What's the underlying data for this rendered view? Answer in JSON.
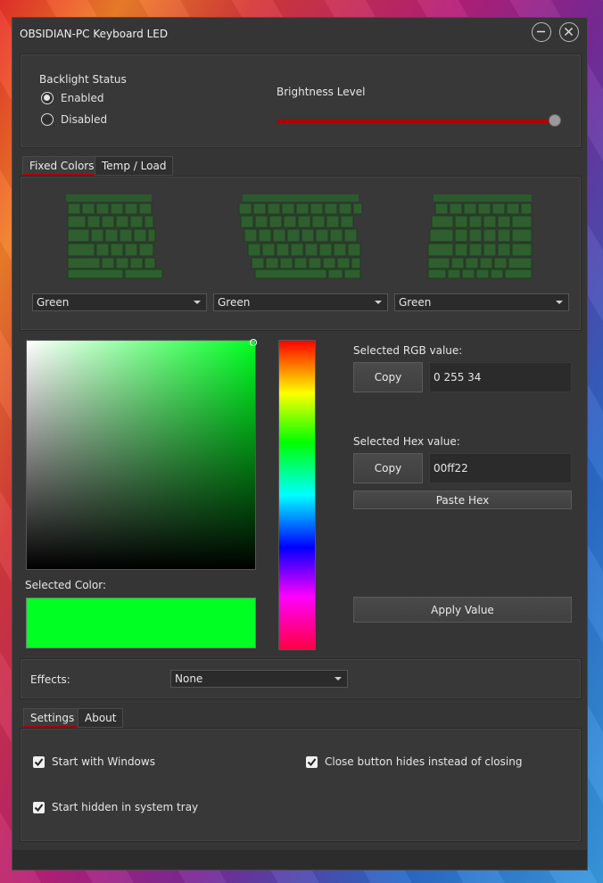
{
  "window": {
    "title": "OBSIDIAN-PC Keyboard LED"
  },
  "backlight": {
    "status_label": "Backlight Status",
    "enabled_label": "Enabled",
    "disabled_label": "Disabled",
    "selected": "Enabled",
    "brightness_label": "Brightness Level",
    "brightness_value": 1.0
  },
  "color_tabs": [
    {
      "label": "Fixed Colors",
      "active": true
    },
    {
      "label": "Temp / Load",
      "active": false
    }
  ],
  "zones": [
    {
      "color": "Green"
    },
    {
      "color": "Green"
    },
    {
      "color": "Green"
    }
  ],
  "picker": {
    "selected_color_label": "Selected Color:",
    "selected_color_hex": "#00ff22",
    "rgb_label": "Selected RGB value:",
    "rgb_value": "0 255 34",
    "hex_label": "Selected Hex value:",
    "hex_value": "00ff22",
    "copy_label": "Copy",
    "paste_hex_label": "Paste Hex",
    "apply_label": "Apply Value"
  },
  "effects": {
    "label": "Effects:",
    "value": "None"
  },
  "settings_tabs": [
    {
      "label": "Settings",
      "active": true
    },
    {
      "label": "About",
      "active": false
    }
  ],
  "settings": {
    "start_with_windows": {
      "label": "Start with Windows",
      "checked": true
    },
    "close_hides": {
      "label": "Close button hides instead of closing",
      "checked": true
    },
    "start_hidden": {
      "label": "Start hidden in system tray",
      "checked": true
    }
  },
  "colors": {
    "accent": "#b00000",
    "keyboard_key": "#2c5a2c",
    "panel": "#383838",
    "window": "#353535"
  }
}
